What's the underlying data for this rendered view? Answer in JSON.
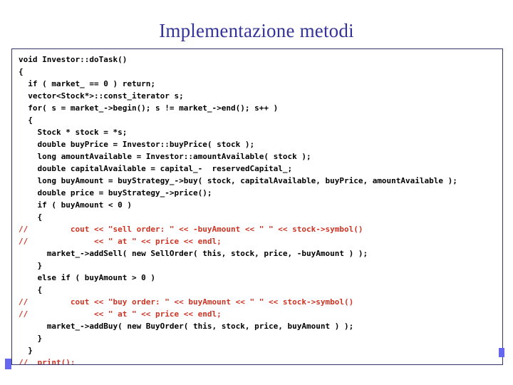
{
  "slide": {
    "title": "Implementazione metodi",
    "title_color": "#333399",
    "background_color": "#ffffff"
  },
  "code_box": {
    "border_color": "#333366",
    "background_color": "#ffffff",
    "comment_color": "#CC3322",
    "code_color": "#000000",
    "language": "cpp",
    "lines": [
      {
        "text": "void Investor::doTask()",
        "comment": false
      },
      {
        "text": "{",
        "comment": false
      },
      {
        "text": "  if ( market_ == 0 ) return;",
        "comment": false
      },
      {
        "text": "  vector<Stock*>::const_iterator s;",
        "comment": false
      },
      {
        "text": "  for( s = market_->begin(); s != market_->end(); s++ )",
        "comment": false
      },
      {
        "text": "  {",
        "comment": false
      },
      {
        "text": "    Stock * stock = *s;",
        "comment": false
      },
      {
        "text": "    double buyPrice = Investor::buyPrice( stock );",
        "comment": false
      },
      {
        "text": "    long amountAvailable = Investor::amountAvailable( stock );",
        "comment": false
      },
      {
        "text": "    double capitalAvailable = capital_-  reservedCapital_;",
        "comment": false
      },
      {
        "text": "    long buyAmount = buyStrategy_->buy( stock, capitalAvailable, buyPrice, amountAvailable );",
        "comment": false
      },
      {
        "text": "    double price = buyStrategy_->price();",
        "comment": false
      },
      {
        "text": "    if ( buyAmount < 0 )",
        "comment": false
      },
      {
        "text": "    {",
        "comment": false
      },
      {
        "text": "//         cout << \"sell order: \" << -buyAmount << \" \" << stock->symbol()",
        "comment": true
      },
      {
        "text": "//              << \" at \" << price << endl;",
        "comment": true
      },
      {
        "text": "      market_->addSell( new SellOrder( this, stock, price, -buyAmount ) );",
        "comment": false
      },
      {
        "text": "    }",
        "comment": false
      },
      {
        "text": "    else if ( buyAmount > 0 )",
        "comment": false
      },
      {
        "text": "    {",
        "comment": false
      },
      {
        "text": "//         cout << \"buy order: \" << buyAmount << \" \" << stock->symbol()",
        "comment": true
      },
      {
        "text": "//              << \" at \" << price << endl;",
        "comment": true
      },
      {
        "text": "      market_->addBuy( new BuyOrder( this, stock, price, buyAmount ) );",
        "comment": false
      },
      {
        "text": "    }",
        "comment": false
      },
      {
        "text": "  }",
        "comment": false
      },
      {
        "text": "//  print();",
        "comment": true
      },
      {
        "text": "}",
        "comment": false
      }
    ]
  },
  "markers": {
    "color": "#6666ee",
    "left_label": "left-edge-marker",
    "right_label": "right-edge-marker"
  }
}
